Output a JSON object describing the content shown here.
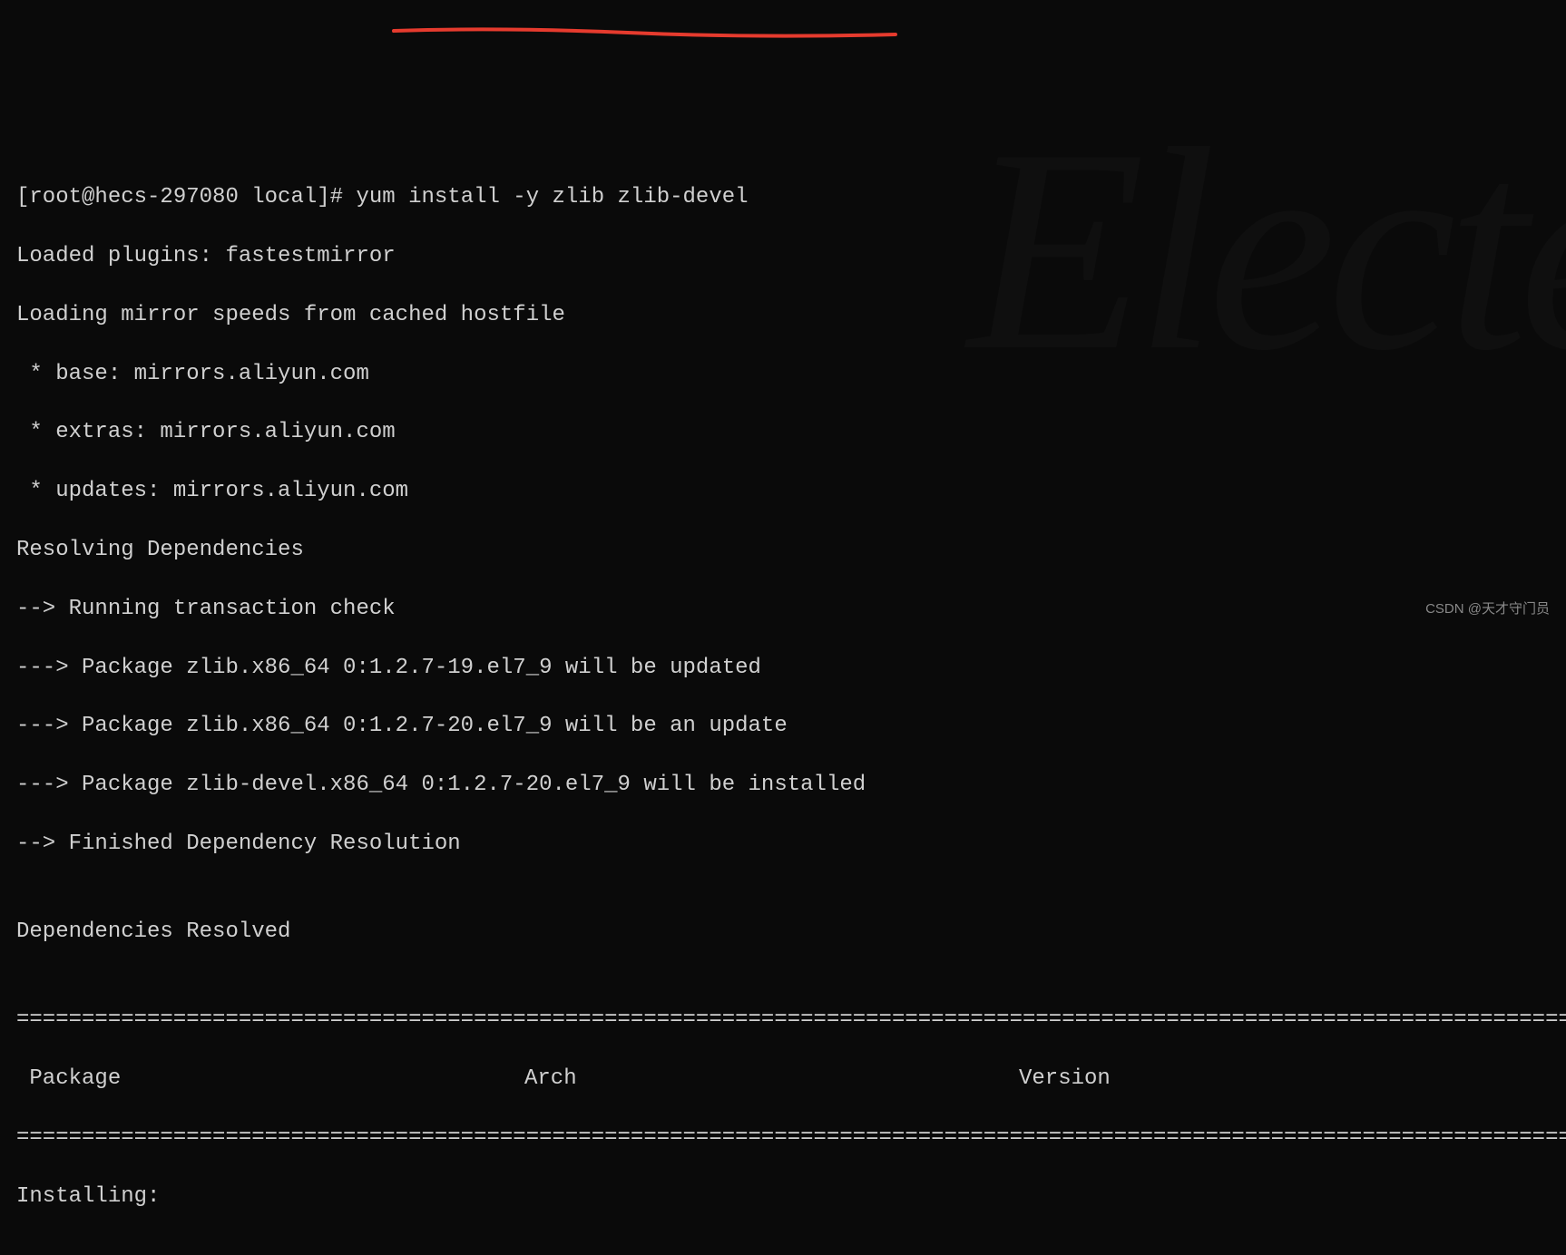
{
  "terminal": {
    "prompt": "[root@hecs-297080 local]# ",
    "command": "yum install -y zlib zlib-devel",
    "output": {
      "line1": "Loaded plugins: fastestmirror",
      "line2": "Loading mirror speeds from cached hostfile",
      "mirror_base": " * base: mirrors.aliyun.com",
      "mirror_extras": " * extras: mirrors.aliyun.com",
      "mirror_updates": " * updates: mirrors.aliyun.com",
      "resolving": "Resolving Dependencies",
      "running_check": "--> Running transaction check",
      "pkg1": "---> Package zlib.x86_64 0:1.2.7-19.el7_9 will be updated",
      "pkg2": "---> Package zlib.x86_64 0:1.2.7-20.el7_9 will be an update",
      "pkg3": "---> Package zlib-devel.x86_64 0:1.2.7-20.el7_9 will be installed",
      "finished": "--> Finished Dependency Resolution",
      "blank": "",
      "deps_resolved": "Dependencies Resolved",
      "blank2": "",
      "divider": "=========================================================================================================================",
      "header_package": " Package",
      "header_arch": "Arch",
      "header_version": "Version",
      "divider2": "=========================================================================================================================",
      "installing": "Installing:"
    }
  },
  "watermark_text": "CSDN @天才守门员",
  "bg_watermark": "Electe"
}
